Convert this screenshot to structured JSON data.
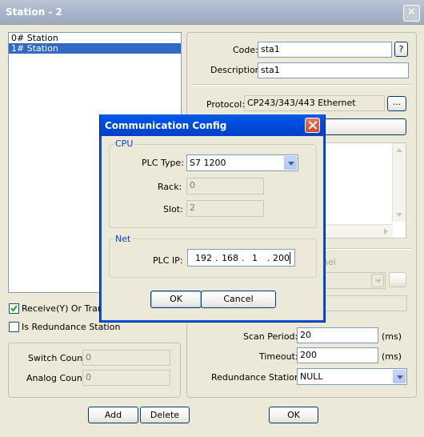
{
  "window": {
    "title": "Station - 2",
    "close_glyph": "✕"
  },
  "station_list": {
    "items": [
      {
        "label": "0# Station",
        "selected": false
      },
      {
        "label": "1# Station",
        "selected": true
      }
    ]
  },
  "left_options": {
    "receive_label": "Receive(Y) Or Trans",
    "receive_checked": true,
    "redundance_label": "Is Redundance Station",
    "redundance_checked": false
  },
  "counts": {
    "switch_label": "Switch Count:",
    "switch_value": "0",
    "analog_label": "Analog Count:",
    "analog_value": "0"
  },
  "left_buttons": {
    "add": "Add",
    "delete": "Delete"
  },
  "right_panel": {
    "code_label": "Code:",
    "code_value": "sta1",
    "help_label": "?",
    "description_label": "Description:",
    "description_value": "sta1",
    "protocol_label": "Protocol:",
    "protocol_value": "CP243/343/443 Ethernet",
    "browse_label": "...",
    "channel_label_fragment": "nel",
    "scan_period_label": "Scan Period:",
    "scan_period_value": "20",
    "scan_period_unit": "(ms)",
    "timeout_label": "Timeout:",
    "timeout_value": "200",
    "timeout_unit": "(ms)",
    "redundance_station_label": "Redundance Station:",
    "redundance_station_value": "NULL",
    "ok_label": "OK"
  },
  "dialog": {
    "title": "Communication Config",
    "cpu_group": "CPU",
    "plc_type_label": "PLC Type:",
    "plc_type_value": "S7 1200",
    "rack_label": "Rack:",
    "rack_value": "0",
    "slot_label": "Slot:",
    "slot_value": "2",
    "net_group": "Net",
    "plc_ip_label": "PLC IP:",
    "ip": [
      "192",
      "168",
      "1",
      "200"
    ],
    "ip_separator": ".",
    "ok_label": "OK",
    "cancel_label": "Cancel"
  },
  "colors": {
    "title_active": "#0054e3",
    "selection": "#316ac5",
    "group_title": "#0046d5"
  }
}
